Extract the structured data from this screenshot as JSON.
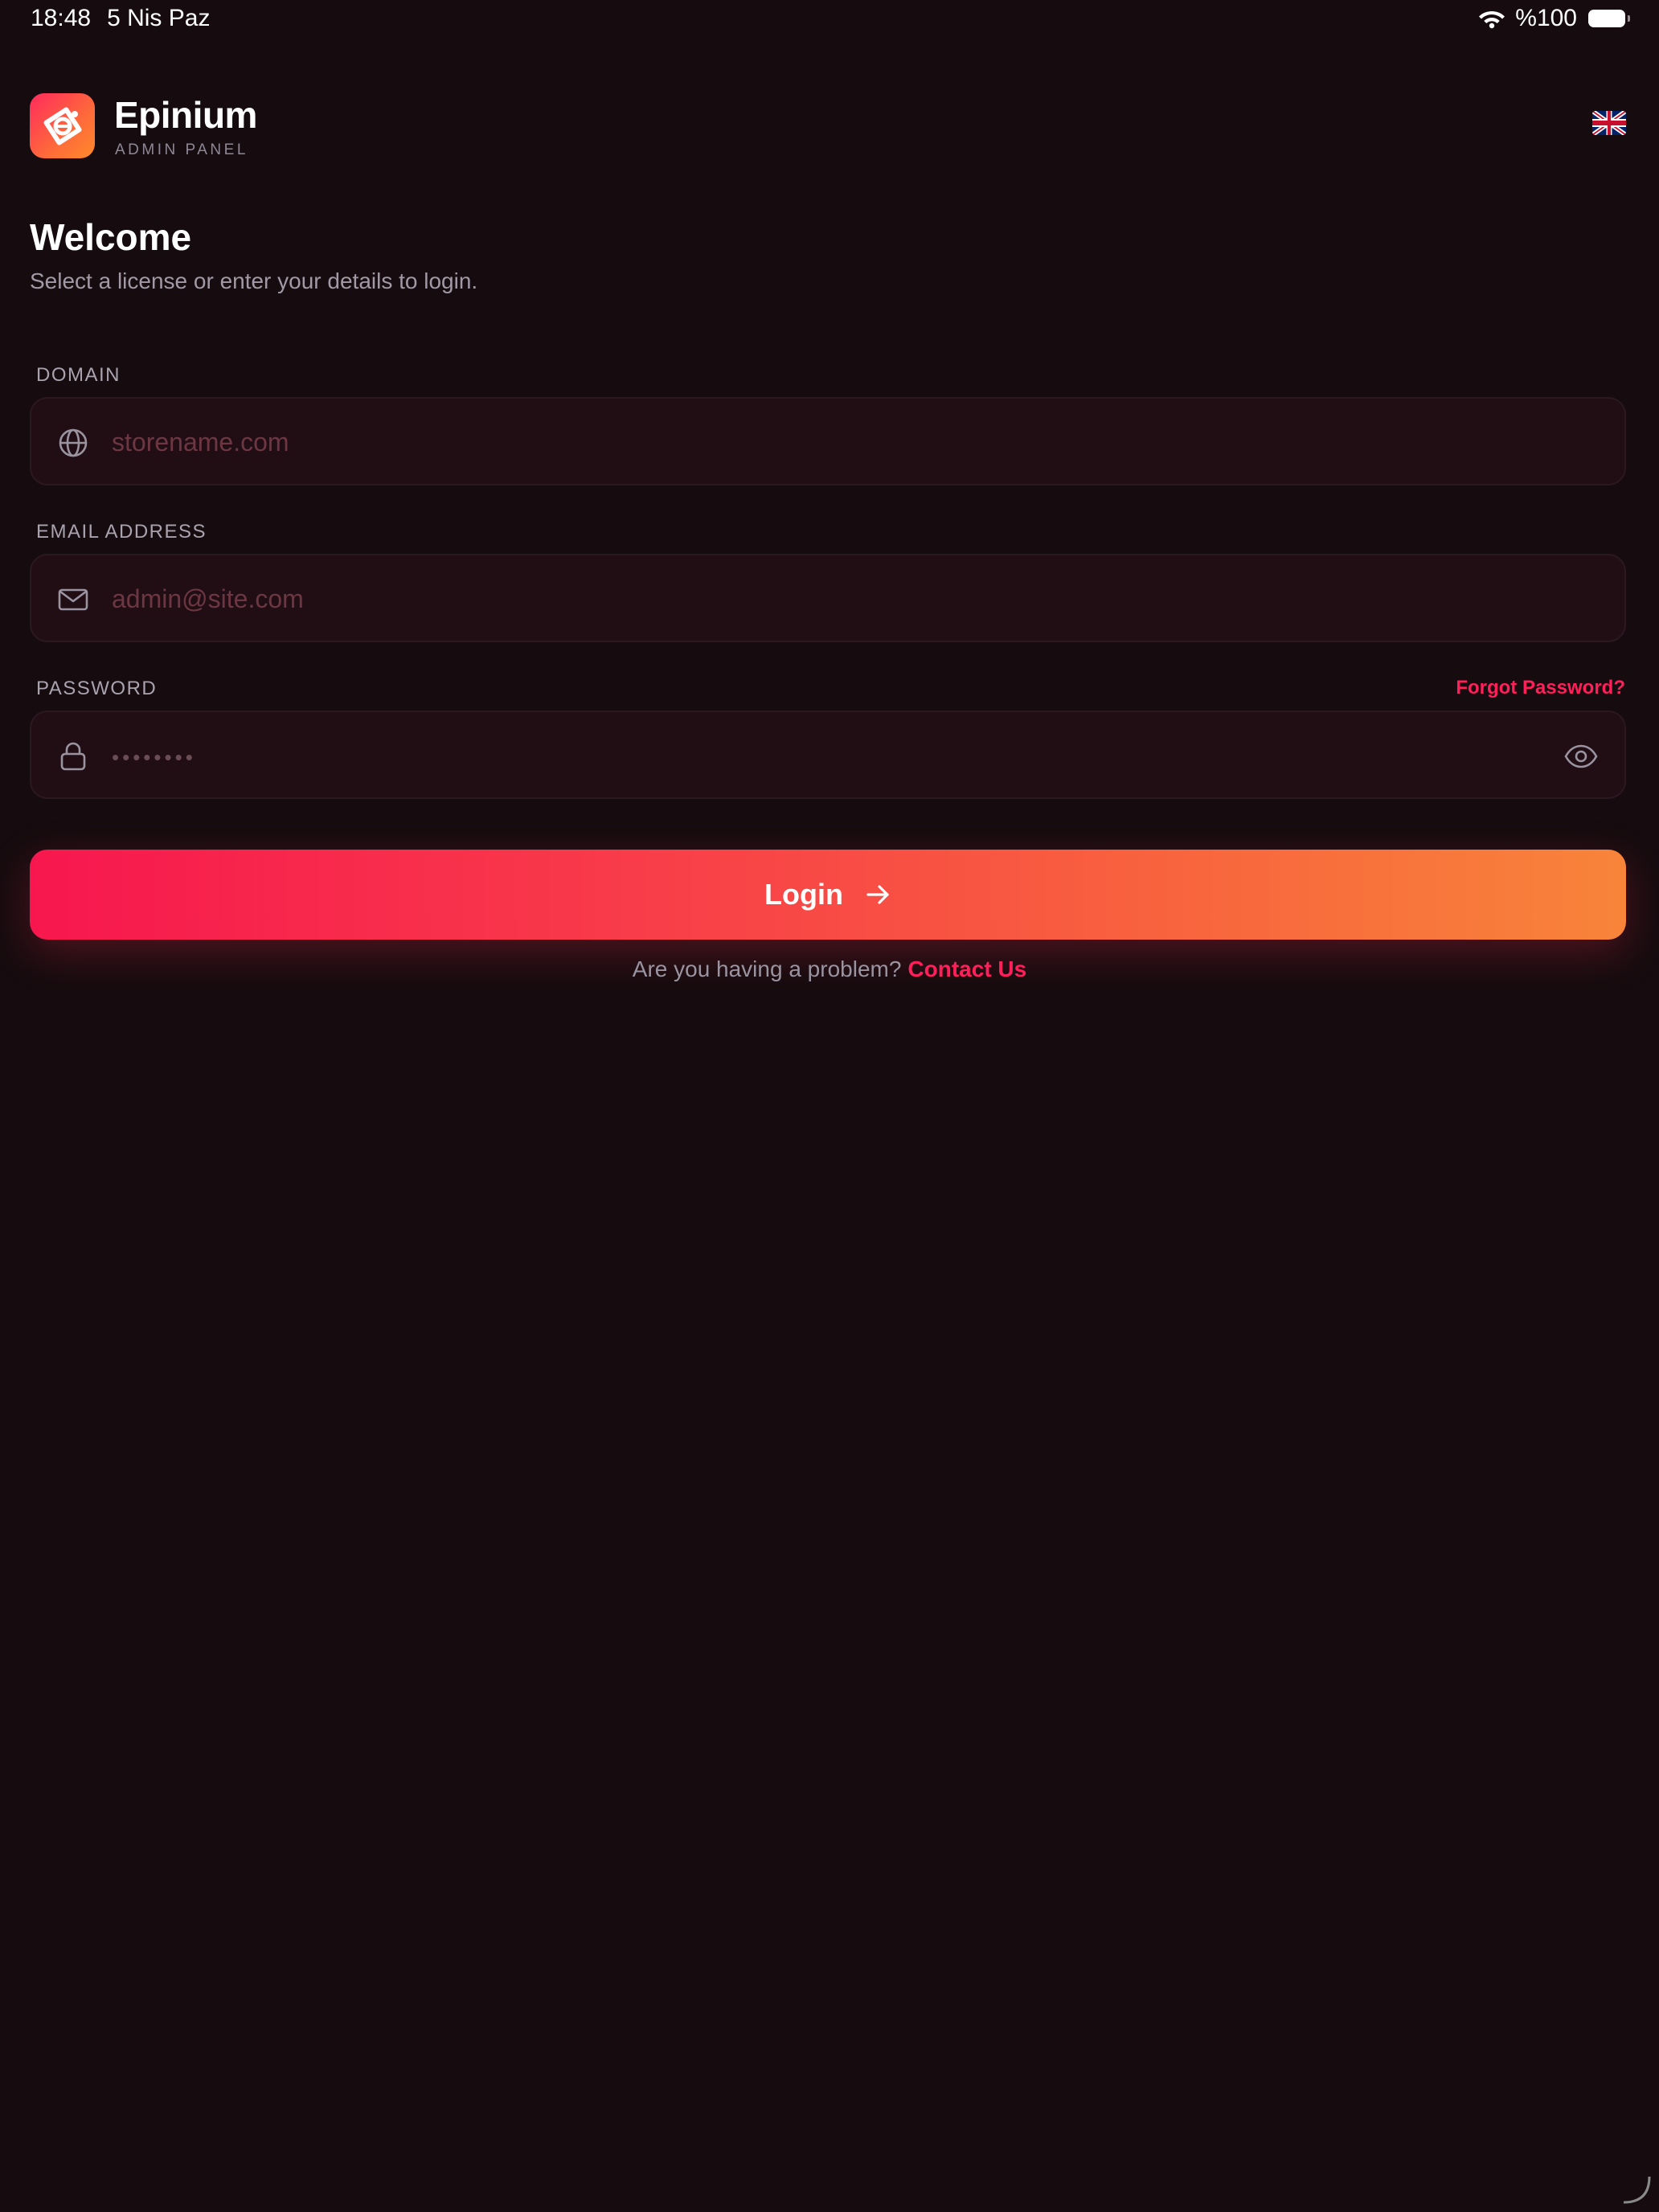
{
  "status_bar": {
    "time": "18:48",
    "date": "5 Nis Paz",
    "battery_percent": "%100",
    "icons": [
      "wifi-icon",
      "battery-icon"
    ]
  },
  "header": {
    "app_name": "Epinium",
    "app_subtitle": "ADMIN PANEL",
    "language_flag": "uk-flag-icon"
  },
  "welcome": {
    "title": "Welcome",
    "subtitle": "Select a license or enter your details to login."
  },
  "form": {
    "domain": {
      "label": "DOMAIN",
      "placeholder": "storename.com",
      "value": "",
      "icon": "globe-icon"
    },
    "email": {
      "label": "EMAIL ADDRESS",
      "placeholder": "admin@site.com",
      "value": "",
      "icon": "mail-icon"
    },
    "password": {
      "label": "PASSWORD",
      "placeholder": "••••••••",
      "value": "",
      "icon": "lock-icon",
      "toggle_icon": "eye-icon"
    },
    "forgot_password": "Forgot Password?",
    "login_label": "Login",
    "help_text": "Are you having a problem?",
    "contact_link": "Contact Us"
  },
  "colors": {
    "background": "#160c0f",
    "field_background": "#210e15",
    "accent": "#ff1f5a",
    "gradient_start": "#f7174e",
    "gradient_end": "#f8843a"
  }
}
